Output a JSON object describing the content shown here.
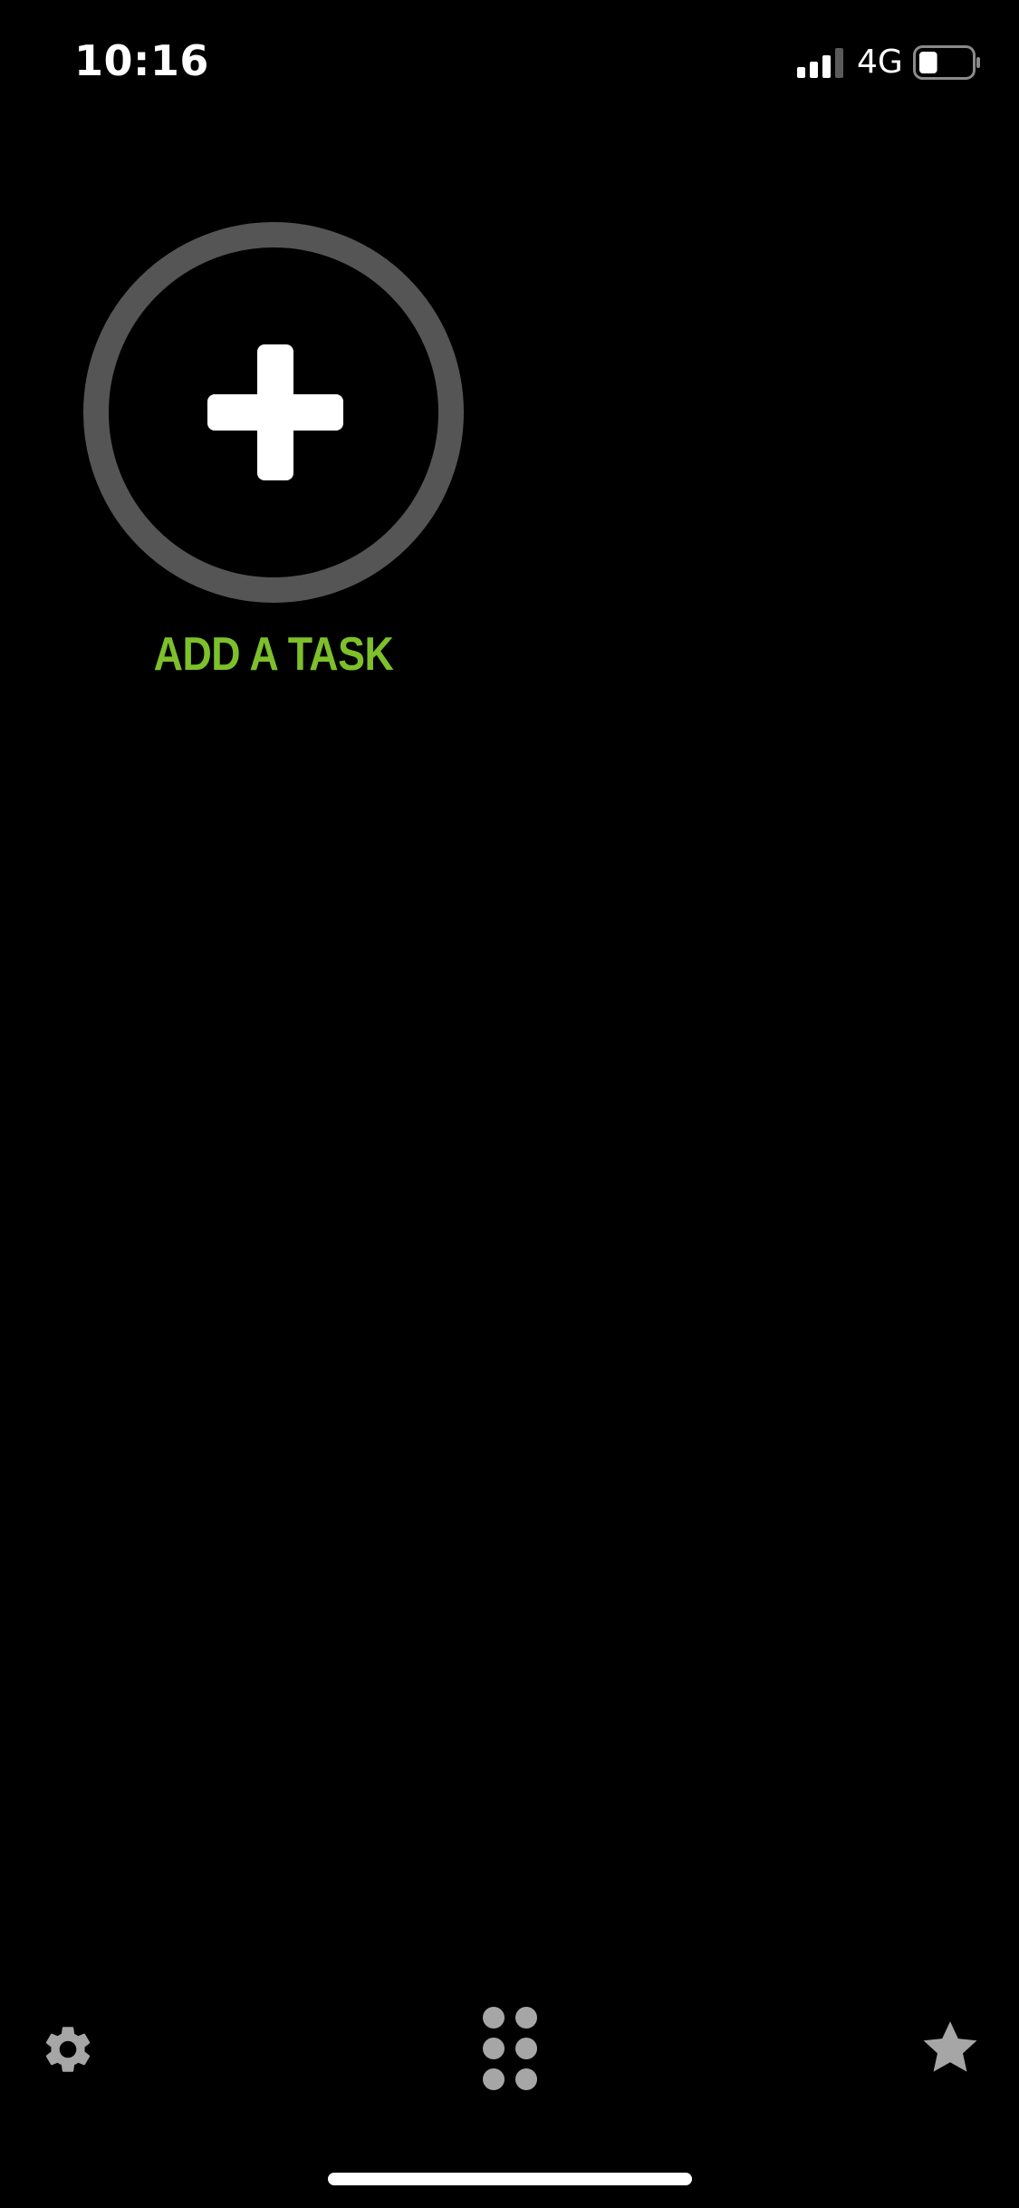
{
  "status_bar": {
    "time": "10:16",
    "network": "4G",
    "signal_icon": "signal-bars-icon",
    "battery_icon": "battery-icon",
    "battery_level": 0.35
  },
  "main": {
    "add_task": {
      "icon": "plus-icon",
      "label": "ADD A TASK",
      "label_color": "#7dc02b",
      "ring_color": "#555555"
    }
  },
  "bottom_bar": {
    "settings_icon": "gear-icon",
    "menu_icon": "grid-dots-icon",
    "favorites_icon": "star-icon",
    "icon_color": "#a6a6a6"
  }
}
